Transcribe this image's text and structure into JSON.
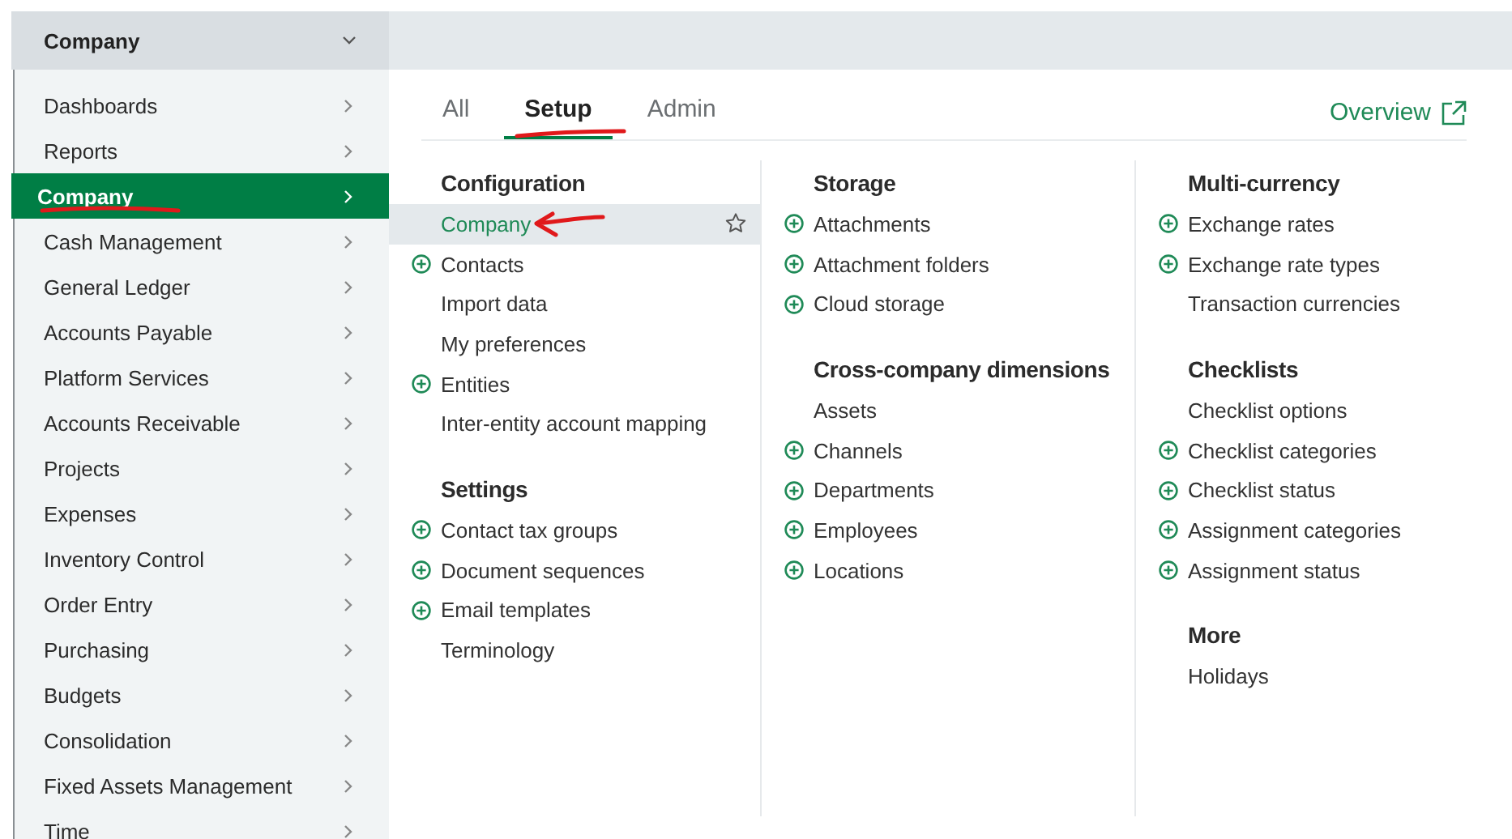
{
  "header": {
    "title": "Company"
  },
  "sidebar": {
    "items": [
      {
        "label": "Dashboards",
        "selected": false
      },
      {
        "label": "Reports",
        "selected": false
      },
      {
        "label": "Company",
        "selected": true
      },
      {
        "label": "Cash Management",
        "selected": false
      },
      {
        "label": "General Ledger",
        "selected": false
      },
      {
        "label": "Accounts Payable",
        "selected": false
      },
      {
        "label": "Platform Services",
        "selected": false
      },
      {
        "label": "Accounts Receivable",
        "selected": false
      },
      {
        "label": "Projects",
        "selected": false
      },
      {
        "label": "Expenses",
        "selected": false
      },
      {
        "label": "Inventory Control",
        "selected": false
      },
      {
        "label": "Order Entry",
        "selected": false
      },
      {
        "label": "Purchasing",
        "selected": false
      },
      {
        "label": "Budgets",
        "selected": false
      },
      {
        "label": "Consolidation",
        "selected": false
      },
      {
        "label": "Fixed Assets Management",
        "selected": false
      },
      {
        "label": "Time",
        "selected": false
      }
    ]
  },
  "tabs": [
    {
      "label": "All",
      "selected": false
    },
    {
      "label": "Setup",
      "selected": true
    },
    {
      "label": "Admin",
      "selected": false
    }
  ],
  "overview_link": "Overview",
  "columns": [
    {
      "groups": [
        {
          "title": "Configuration",
          "items": [
            {
              "label": "Company",
              "add": false,
              "selected": true
            },
            {
              "label": "Contacts",
              "add": true,
              "selected": false
            },
            {
              "label": "Import data",
              "add": false,
              "selected": false
            },
            {
              "label": "My preferences",
              "add": false,
              "selected": false
            },
            {
              "label": "Entities",
              "add": true,
              "selected": false
            },
            {
              "label": "Inter-entity account mapping",
              "add": false,
              "selected": false
            }
          ]
        },
        {
          "title": "Settings",
          "items": [
            {
              "label": "Contact tax groups",
              "add": true,
              "selected": false
            },
            {
              "label": "Document sequences",
              "add": true,
              "selected": false
            },
            {
              "label": "Email templates",
              "add": true,
              "selected": false
            },
            {
              "label": "Terminology",
              "add": false,
              "selected": false
            }
          ]
        }
      ]
    },
    {
      "groups": [
        {
          "title": "Storage",
          "items": [
            {
              "label": "Attachments",
              "add": true,
              "selected": false
            },
            {
              "label": "Attachment folders",
              "add": true,
              "selected": false
            },
            {
              "label": "Cloud storage",
              "add": true,
              "selected": false
            }
          ]
        },
        {
          "title": "Cross-company dimensions",
          "items": [
            {
              "label": "Assets",
              "add": false,
              "selected": false
            },
            {
              "label": "Channels",
              "add": true,
              "selected": false
            },
            {
              "label": "Departments",
              "add": true,
              "selected": false
            },
            {
              "label": "Employees",
              "add": true,
              "selected": false
            },
            {
              "label": "Locations",
              "add": true,
              "selected": false
            }
          ]
        }
      ]
    },
    {
      "groups": [
        {
          "title": "Multi-currency",
          "items": [
            {
              "label": "Exchange rates",
              "add": true,
              "selected": false
            },
            {
              "label": "Exchange rate types",
              "add": true,
              "selected": false
            },
            {
              "label": "Transaction currencies",
              "add": false,
              "selected": false
            }
          ]
        },
        {
          "title": "Checklists",
          "items": [
            {
              "label": "Checklist options",
              "add": false,
              "selected": false
            },
            {
              "label": "Checklist categories",
              "add": true,
              "selected": false
            },
            {
              "label": "Checklist status",
              "add": true,
              "selected": false
            },
            {
              "label": "Assignment categories",
              "add": true,
              "selected": false
            },
            {
              "label": "Assignment status",
              "add": true,
              "selected": false
            }
          ]
        },
        {
          "title": "More",
          "items": [
            {
              "label": "Holidays",
              "add": false,
              "selected": false
            }
          ]
        }
      ]
    }
  ]
}
